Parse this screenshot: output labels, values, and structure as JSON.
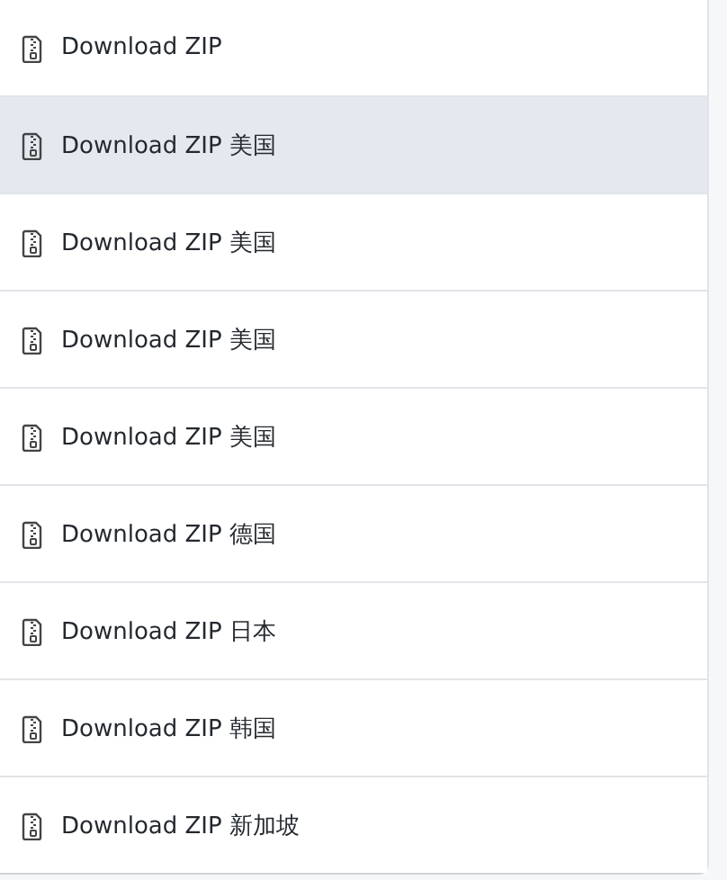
{
  "items": [
    {
      "label": "Download ZIP",
      "selected": false
    },
    {
      "label": "Download ZIP 美国",
      "selected": true
    },
    {
      "label": "Download ZIP 美国",
      "selected": false
    },
    {
      "label": "Download ZIP 美国",
      "selected": false
    },
    {
      "label": "Download ZIP 美国",
      "selected": false
    },
    {
      "label": "Download ZIP 德国",
      "selected": false
    },
    {
      "label": "Download ZIP 日本",
      "selected": false
    },
    {
      "label": "Download ZIP 韩国",
      "selected": false
    },
    {
      "label": "Download ZIP 新加坡",
      "selected": false
    }
  ]
}
